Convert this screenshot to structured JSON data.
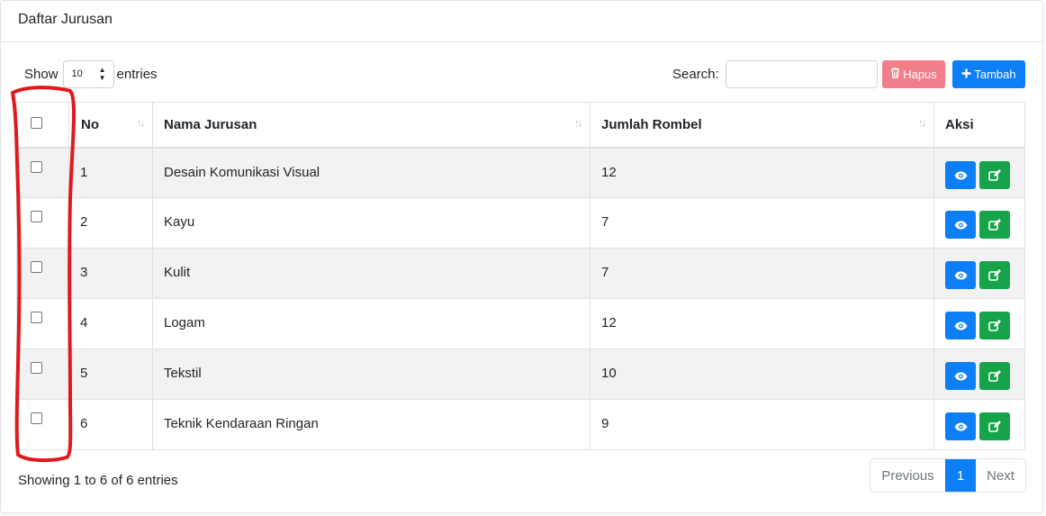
{
  "card": {
    "title": "Daftar Jurusan"
  },
  "length": {
    "show_label": "Show",
    "value": "10",
    "entries_label": "entries"
  },
  "search": {
    "label": "Search:",
    "value": ""
  },
  "buttons": {
    "hapus": "Hapus",
    "tambah": "Tambah"
  },
  "table": {
    "headers": {
      "no": "No",
      "nama": "Nama Jurusan",
      "jumlah": "Jumlah Rombel",
      "aksi": "Aksi"
    },
    "rows": [
      {
        "no": "1",
        "nama": "Desain Komunikasi Visual",
        "jumlah": "12"
      },
      {
        "no": "2",
        "nama": "Kayu",
        "jumlah": "7"
      },
      {
        "no": "3",
        "nama": "Kulit",
        "jumlah": "7"
      },
      {
        "no": "4",
        "nama": "Logam",
        "jumlah": "12"
      },
      {
        "no": "5",
        "nama": "Tekstil",
        "jumlah": "10"
      },
      {
        "no": "6",
        "nama": "Teknik Kendaraan Ringan",
        "jumlah": "9"
      }
    ]
  },
  "footer": {
    "info": "Showing 1 to 6 of 6 entries"
  },
  "pagination": {
    "previous": "Previous",
    "current": "1",
    "next": "Next"
  },
  "colors": {
    "primary": "#0d7ff6",
    "danger": "#f27e8a",
    "success": "#16a34a",
    "annotation": "#e0191d"
  }
}
